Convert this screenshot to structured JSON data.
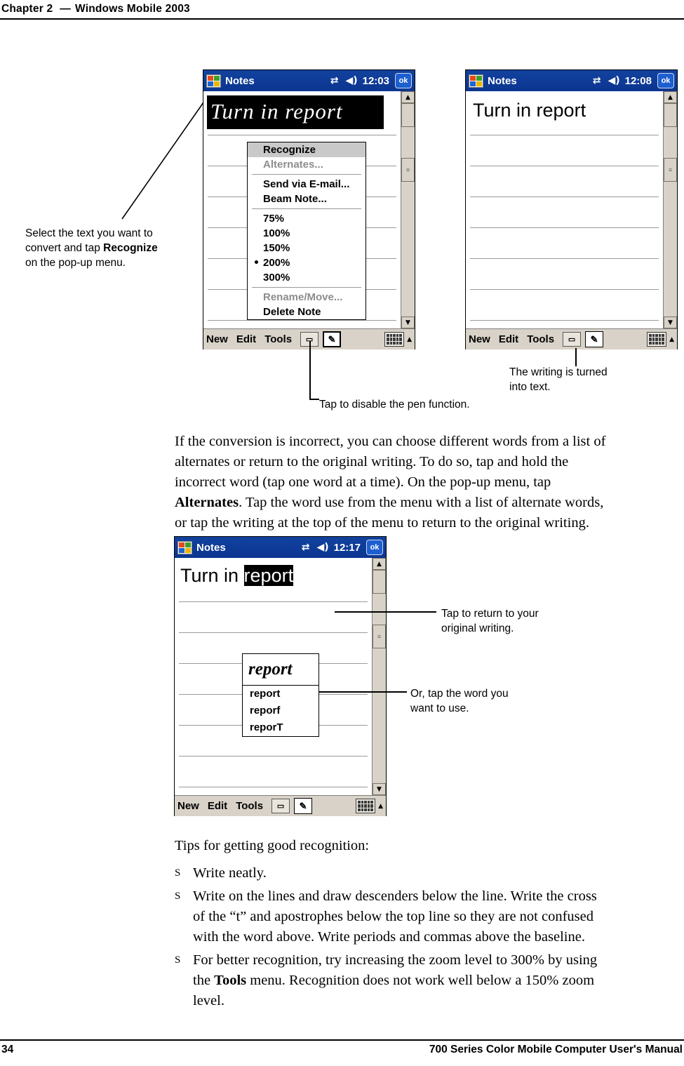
{
  "header": {
    "chapter": "Chapter  2",
    "dash": "—",
    "title": "Windows Mobile 2003"
  },
  "footer": {
    "page_number": "34",
    "manual_title": "700 Series Color Mobile Computer User's Manual"
  },
  "figure1": {
    "left_device": {
      "app_name": "Notes",
      "time": "12:03",
      "ok_label": "ok",
      "icons": [
        "connectivity-icon",
        "speaker-icon"
      ],
      "ink_text": "Turn in report",
      "popup_menu": {
        "items": [
          {
            "label": "Recognize",
            "state": "highlighted"
          },
          {
            "label": "Alternates...",
            "state": "disabled"
          },
          {
            "label": "Send via E-mail...",
            "state": "normal"
          },
          {
            "label": "Beam Note...",
            "state": "normal"
          },
          {
            "label": "75%",
            "state": "normal"
          },
          {
            "label": "100%",
            "state": "normal"
          },
          {
            "label": "150%",
            "state": "normal"
          },
          {
            "label": "200%",
            "state": "checked"
          },
          {
            "label": "300%",
            "state": "normal"
          },
          {
            "label": "Rename/Move...",
            "state": "disabled"
          },
          {
            "label": "Delete Note",
            "state": "normal"
          }
        ]
      },
      "command_bar": {
        "new": "New",
        "edit": "Edit",
        "tools": "Tools",
        "record_icon": "record-icon",
        "pen_icon": "pen-icon",
        "keyboard_icon": "keyboard-icon",
        "keyboard_arrow": "▲"
      }
    },
    "right_device": {
      "app_name": "Notes",
      "time": "12:08",
      "ok_label": "ok",
      "typed_text": "Turn in report",
      "command_bar": {
        "new": "New",
        "edit": "Edit",
        "tools": "Tools",
        "record_icon": "record-icon",
        "pen_icon": "pen-icon",
        "keyboard_icon": "keyboard-icon",
        "keyboard_arrow": "▲"
      }
    },
    "callouts": {
      "select_text": {
        "line1": "Select the text you want to",
        "line2_pre": "convert and tap ",
        "line2_bold": "Recognize",
        "line3": "on the pop-up menu."
      },
      "disable_pen": "Tap to disable the pen function.",
      "turned_into_text": {
        "line1": "The writing is turned",
        "line2": "into text."
      }
    }
  },
  "paragraph1": {
    "line1": "If the conversion is incorrect, you can choose different words from a list of",
    "line2": "alternates or return to the original writing. To do so, tap and hold the",
    "line3": "incorrect word (tap one word at a time). On the pop-up menu, tap",
    "line4_bold": "Alternates",
    "line4_rest": ". Tap the word use from the menu with a list of alternate words,",
    "line5": "or tap the writing at the top of the menu to return to the original writing."
  },
  "figure2": {
    "device": {
      "app_name": "Notes",
      "time": "12:17",
      "ok_label": "ok",
      "typed_text_normal": "Turn in ",
      "typed_text_selected": "report",
      "alternates": {
        "ink": "report",
        "items": [
          "report",
          "reporf",
          "reporT"
        ]
      },
      "command_bar": {
        "new": "New",
        "edit": "Edit",
        "tools": "Tools",
        "record_icon": "record-icon",
        "pen_icon": "pen-icon",
        "keyboard_icon": "keyboard-icon",
        "keyboard_arrow": "▲"
      }
    },
    "callouts": {
      "return_original": {
        "line1": "Tap to return to your",
        "line2": "original writing."
      },
      "tap_word": {
        "line1": "Or, tap the word you",
        "line2": "want to use."
      }
    }
  },
  "tips": {
    "heading": "Tips for getting good recognition:",
    "items": [
      {
        "mark": "S",
        "lines": [
          "Write neatly."
        ]
      },
      {
        "mark": "S",
        "lines": [
          "Write on the lines and draw descenders below the line. Write the cross",
          "of the “t” and apostrophes below the top line so they are not confused",
          "with the word above. Write periods and commas above the baseline."
        ]
      },
      {
        "mark": "S",
        "lines": [
          "For better recognition, try increasing the zoom level to 300% by using",
          "the Tools menu. Recognition does not work well below a 150% zoom",
          "level."
        ],
        "bold_word": "Tools"
      }
    ]
  }
}
